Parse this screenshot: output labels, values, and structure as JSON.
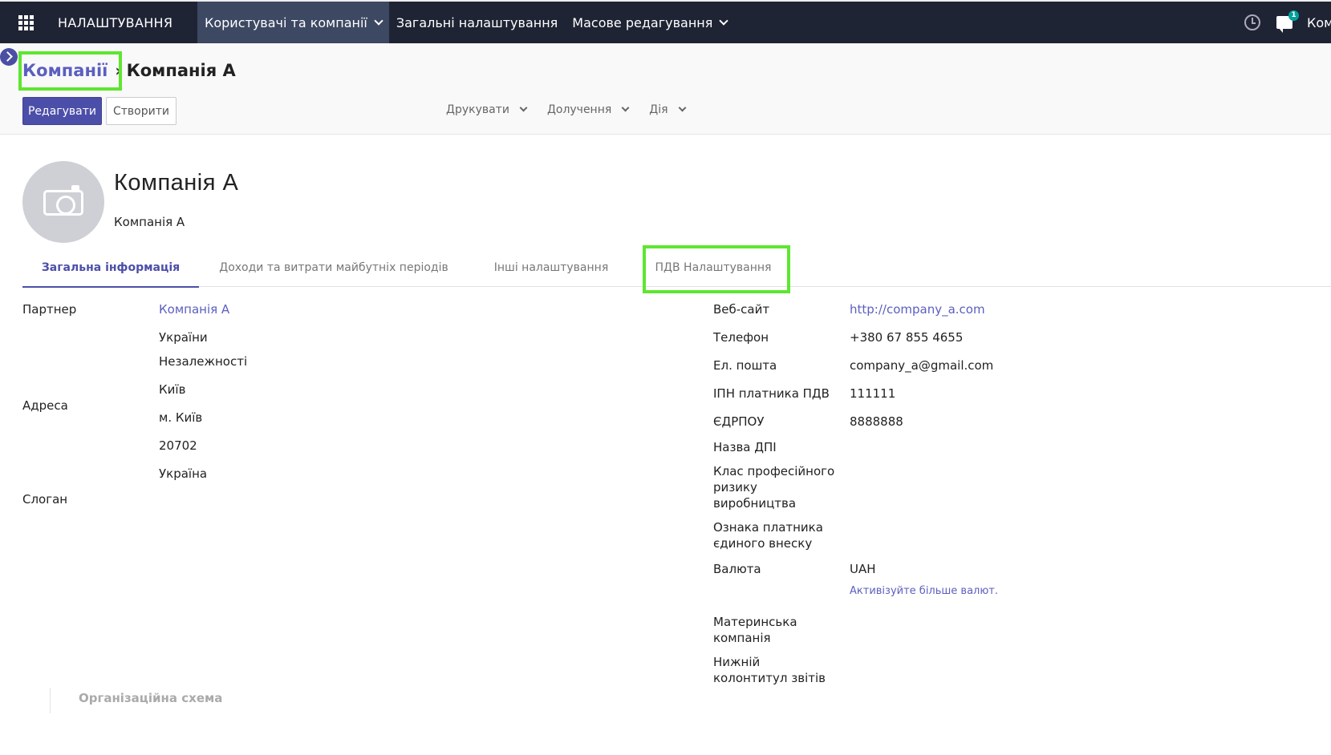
{
  "navbar": {
    "brand": "НАЛАШТУВАННЯ",
    "menu": [
      {
        "label": "Користувачі та компанії",
        "dropdown": true,
        "active": true
      },
      {
        "label": "Загальні налаштування",
        "dropdown": false,
        "active": false
      },
      {
        "label": "Масове редагування",
        "dropdown": true,
        "active": false
      }
    ],
    "chat_badge": "1",
    "company_switcher": "Ком"
  },
  "breadcrumb": {
    "parent": "Компанії",
    "separator": "›",
    "current": "Компанія А"
  },
  "toolbar": {
    "edit_label": "Редагувати",
    "create_label": "Створити",
    "actions": [
      "Друкувати",
      "Долучення",
      "Дія"
    ]
  },
  "record": {
    "title": "Компанія А",
    "subtitle": "Компанія А"
  },
  "tabs": [
    {
      "label": "Загальна інформація",
      "active": true
    },
    {
      "label": "Доходи та витрати майбутніх періодів",
      "active": false
    },
    {
      "label": "Інші налаштування",
      "active": false
    },
    {
      "label": "ПДВ Налаштування",
      "active": false
    }
  ],
  "left_fields": {
    "partner_label": "Партнер",
    "partner_value": "Компанія А",
    "address_label": "Адреса",
    "address_lines": [
      "України",
      "Незалежності",
      "Київ",
      "м. Київ",
      "20702",
      "Україна"
    ],
    "slogan_label": "Слоган"
  },
  "right_fields": {
    "website_label": "Веб-сайт",
    "website_value": "http://company_a.com",
    "phone_label": "Телефон",
    "phone_value": "+380 67 855 4655",
    "email_label": "Ел. пошта",
    "email_value": "company_a@gmail.com",
    "vat_label": "ІПН платника ПДВ",
    "vat_value": "111111",
    "edrpou_label": "ЄДРПОУ",
    "edrpou_value": "8888888",
    "tax_office_label": "Назва ДПІ",
    "risk_class_label": [
      "Клас професійного",
      "ризику",
      "виробництва"
    ],
    "single_tax_label": [
      "Ознака платника",
      "єдиного внеску"
    ],
    "currency_label": "Валюта",
    "currency_value": "UAH",
    "currency_link": "Активізуйте більше валют.",
    "parent_company_label": [
      "Материнська",
      "компанія"
    ],
    "footer_label": [
      "Нижній",
      "колонтитул звітів"
    ]
  },
  "org_chart_title": "Організаційна схема",
  "colors": {
    "navbar_bg": "#1f2434",
    "accent": "#4c4fa9",
    "highlight": "#5ee630"
  }
}
